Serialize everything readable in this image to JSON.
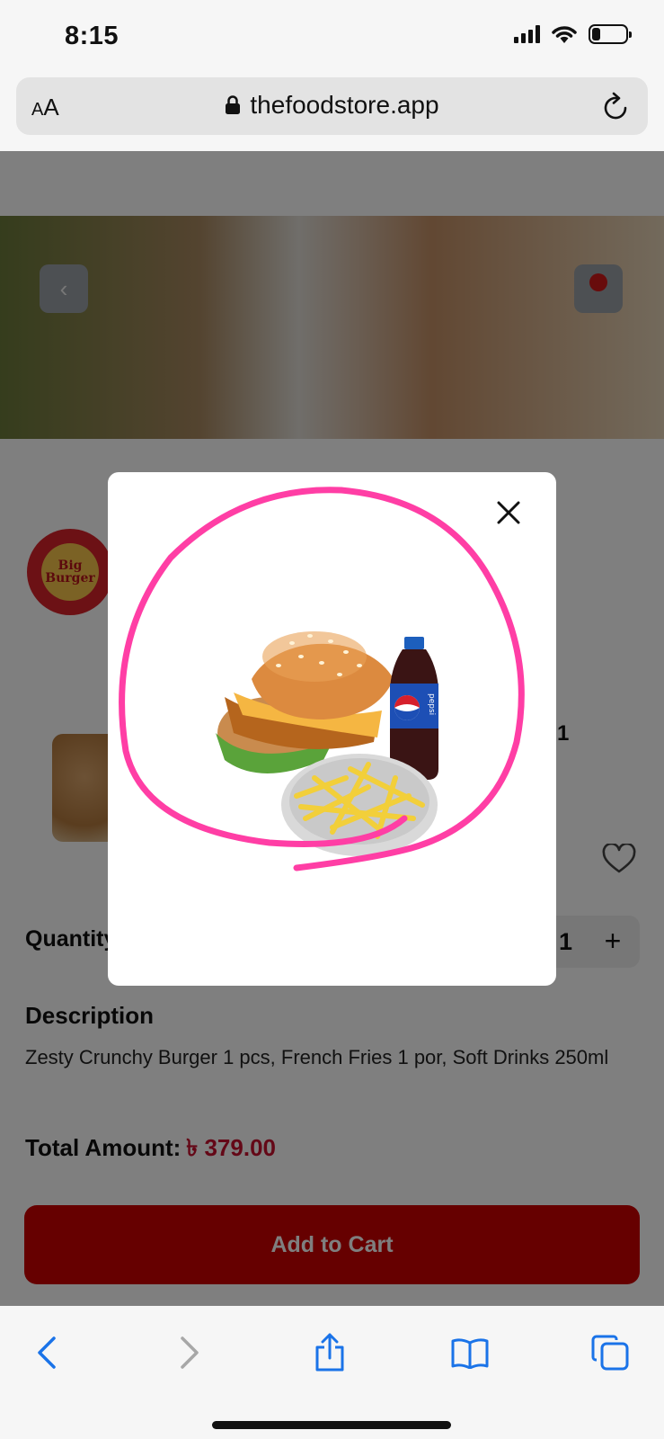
{
  "status_bar": {
    "time": "8:15",
    "battery_level": 0.2
  },
  "address_bar": {
    "text_size_label_small": "A",
    "text_size_label_large": "A",
    "url": "thefoodstore.app"
  },
  "store": {
    "logo_text": "Big Burger"
  },
  "product": {
    "count_partial": "1",
    "quantity_label": "Quantity",
    "quantity_value": "1",
    "quantity_plus": "+",
    "description_title": "Description",
    "description_text": "Zesty Crunchy Burger 1 pcs, French Fries 1 por, Soft Drinks 250ml",
    "total_label": "Total Amount:",
    "total_value": "৳ 379.00",
    "add_to_cart_label": "Add to Cart"
  },
  "modal": {
    "image_alt": "Zesty Crunchy Burger combo with French fries and Pepsi",
    "bottle_brand": "pepsi"
  },
  "colors": {
    "accent_red": "#cc0000",
    "price_red": "#c8102e",
    "annotation_pink": "#ff3ea5",
    "ios_blue": "#1a73e8"
  },
  "toolbar": {
    "icons": [
      "back-icon",
      "forward-icon",
      "share-icon",
      "bookmarks-icon",
      "tabs-icon"
    ]
  }
}
